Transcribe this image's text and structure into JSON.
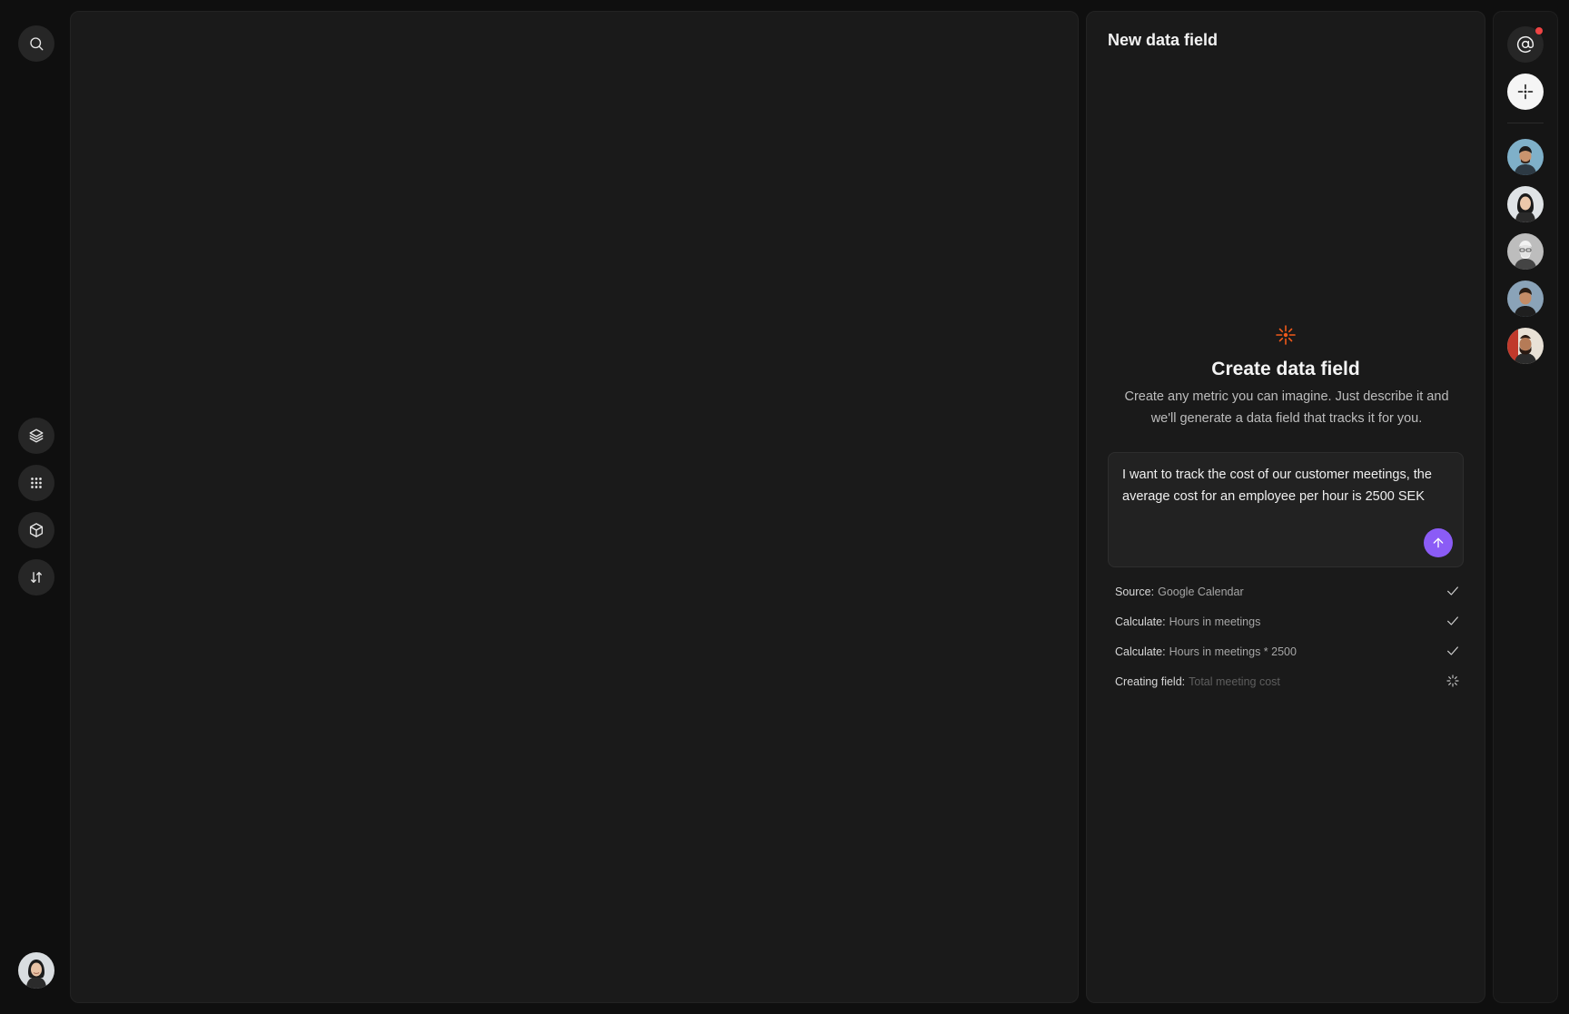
{
  "left_rail": {
    "buttons": [
      {
        "icon": "search-icon"
      },
      {
        "icon": "layers-icon"
      },
      {
        "icon": "grid-icon"
      },
      {
        "icon": "cube-icon"
      },
      {
        "icon": "sort-icon"
      }
    ]
  },
  "panel": {
    "title": "New data field",
    "empty_title": "Create data field",
    "empty_description": "Create any metric you can imagine. Just describe it and we'll generate a data field that tracks it for you.",
    "prompt_value": "I want to track the cost of our customer meetings, the average cost for an employee per hour is 2500 SEK",
    "steps": [
      {
        "label": "Source:",
        "value": "Google Calendar",
        "status": "done"
      },
      {
        "label": "Calculate:",
        "value": "Hours in meetings",
        "status": "done"
      },
      {
        "label": "Calculate:",
        "value": "Hours in meetings * 2500",
        "status": "done"
      },
      {
        "label": "Creating field:",
        "value": "Total meeting cost",
        "status": "loading"
      }
    ]
  },
  "colors": {
    "accent": "#8b5cf6",
    "spark": "#f05a1a",
    "notification": "#ef4444",
    "background": "#0f0f0f",
    "panel": "#1a1a1a"
  }
}
